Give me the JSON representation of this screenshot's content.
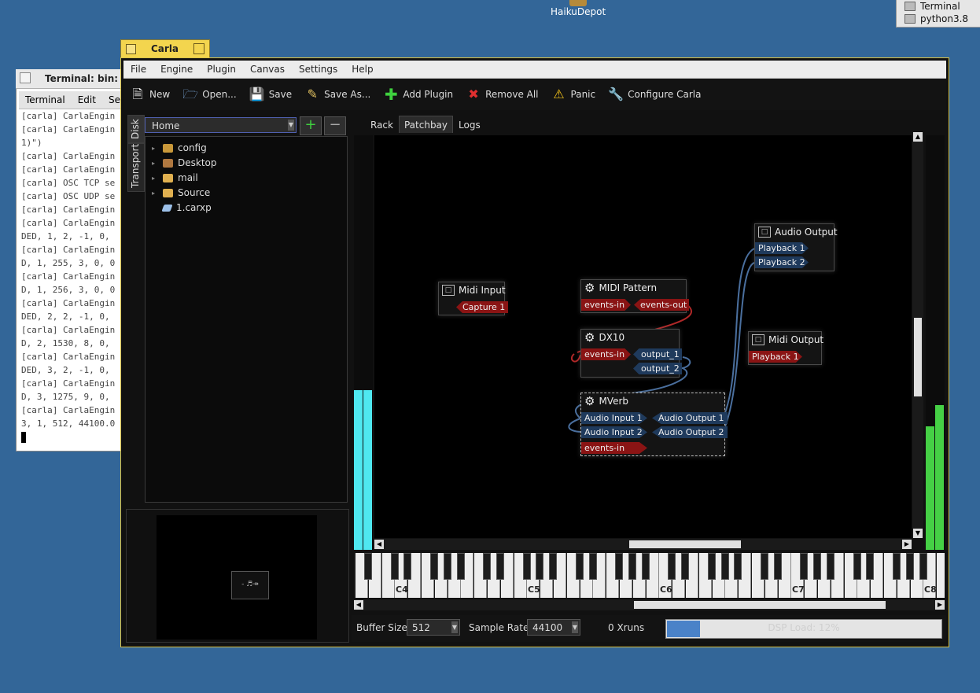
{
  "desktop": {
    "icon_label": "HaikuDepot",
    "deskbar_items": [
      "Terminal",
      "python3.8"
    ]
  },
  "terminal": {
    "title": "Terminal: bin: py",
    "menu": [
      "Terminal",
      "Edit",
      "Sett"
    ],
    "lines": [
      "[carla] CarlaEngin",
      "[carla] CarlaEngin",
      "1)\")",
      "[carla] CarlaEngin",
      "[carla] CarlaEngin",
      "[carla] OSC TCP se",
      "[carla] OSC UDP se",
      "[carla] CarlaEngin",
      "[carla] CarlaEngin",
      "DED, 1, 2, -1, 0,",
      "[carla] CarlaEngin",
      "D, 1, 255, 3, 0, 0",
      "[carla] CarlaEngin",
      "D, 1, 256, 3, 0, 0",
      "[carla] CarlaEngin",
      "DED, 2, 2, -1, 0,",
      "[carla] CarlaEngin",
      "D, 2, 1530, 8, 0,",
      "[carla] CarlaEngin",
      "DED, 3, 2, -1, 0,",
      "[carla] CarlaEngin",
      "D, 3, 1275, 9, 0,",
      "[carla] CarlaEngin",
      "3, 1, 512, 44100.0"
    ]
  },
  "carla": {
    "title": "Carla",
    "menu": [
      "File",
      "Engine",
      "Plugin",
      "Canvas",
      "Settings",
      "Help"
    ],
    "toolbar": [
      {
        "label": "New",
        "icon": "new-file-icon"
      },
      {
        "label": "Open...",
        "icon": "open-folder-icon"
      },
      {
        "label": "Save",
        "icon": "save-icon"
      },
      {
        "label": "Save As...",
        "icon": "save-as-icon"
      },
      {
        "label": "Add Plugin",
        "icon": "add-plugin-icon"
      },
      {
        "label": "Remove All",
        "icon": "remove-all-icon"
      },
      {
        "label": "Panic",
        "icon": "panic-warning-icon"
      },
      {
        "label": "Configure Carla",
        "icon": "wrench-icon"
      }
    ],
    "side_tabs": [
      "Disk",
      "Transport"
    ],
    "folder_combo": "Home",
    "tree": [
      {
        "name": "config",
        "expandable": true
      },
      {
        "name": "Desktop",
        "expandable": true
      },
      {
        "name": "mail",
        "expandable": true
      },
      {
        "name": "Source",
        "expandable": true
      },
      {
        "name": "1.carxp",
        "expandable": false
      }
    ],
    "main_tabs": [
      "Rack",
      "Patchbay",
      "Logs"
    ],
    "active_tab": "Patchbay",
    "patchbay": {
      "midi_input": {
        "title": "Midi Input",
        "ports": [
          "Capture 1"
        ]
      },
      "midi_pattern": {
        "title": "MIDI Pattern",
        "in": "events-in",
        "out": "events-out"
      },
      "dx10": {
        "title": "DX10",
        "in": "events-in",
        "out": [
          "output_1",
          "output_2"
        ]
      },
      "mverb": {
        "title": "MVerb",
        "in": [
          "Audio Input 1",
          "Audio Input 2",
          "events-in"
        ],
        "out": [
          "Audio Output 1",
          "Audio Output 2"
        ]
      },
      "audio_output": {
        "title": "Audio Output",
        "ports": [
          "Playback 1",
          "Playback 2"
        ]
      },
      "midi_output": {
        "title": "Midi Output",
        "ports": [
          "Playback 1"
        ]
      }
    },
    "keyboard_labels": [
      "C4",
      "C5",
      "C6",
      "C7",
      "C8"
    ],
    "status": {
      "buffer_label": "Buffer Size:",
      "buffer_value": "512",
      "rate_label": "Sample Rate:",
      "rate_value": "44100",
      "xruns": "0 Xruns",
      "dsp_text": "DSP Load: 12%",
      "dsp_load": 12
    },
    "colors": {
      "audio_port": "#1f3a5c",
      "midi_port": "#8a1414",
      "meter_left": "#4fe8f0",
      "meter_right": "#45d045",
      "accent": "#f3d54e"
    }
  }
}
